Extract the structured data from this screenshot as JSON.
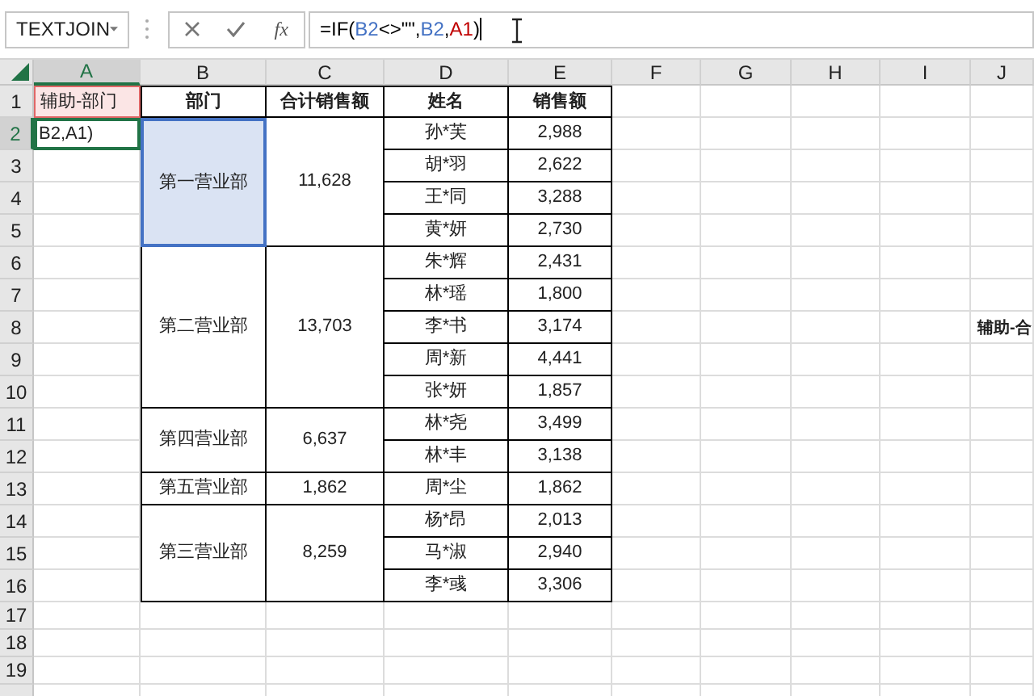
{
  "name_box": {
    "value": "TEXTJOIN"
  },
  "formula_bar": {
    "function_button": "fx",
    "formula": [
      {
        "text": "=IF(",
        "color": "#000000"
      },
      {
        "text": "B2",
        "color": "#4472c4"
      },
      {
        "text": "<>\"\",",
        "color": "#000000"
      },
      {
        "text": "B2",
        "color": "#4472c4"
      },
      {
        "text": ",",
        "color": "#000000"
      },
      {
        "text": "A1",
        "color": "#c00000"
      },
      {
        "text": ")",
        "color": "#000000"
      }
    ]
  },
  "columns": [
    {
      "label": "A",
      "selected": true
    },
    {
      "label": "B",
      "selected": false
    },
    {
      "label": "C",
      "selected": false
    },
    {
      "label": "D",
      "selected": false
    },
    {
      "label": "E",
      "selected": false
    },
    {
      "label": "F",
      "selected": false
    },
    {
      "label": "G",
      "selected": false
    },
    {
      "label": "H",
      "selected": false
    },
    {
      "label": "I",
      "selected": false
    },
    {
      "label": "J",
      "selected": false
    }
  ],
  "rows": [
    {
      "label": "1",
      "selected": false
    },
    {
      "label": "2",
      "selected": true
    },
    {
      "label": "3",
      "selected": false
    },
    {
      "label": "4",
      "selected": false
    },
    {
      "label": "5",
      "selected": false
    },
    {
      "label": "6",
      "selected": false
    },
    {
      "label": "7",
      "selected": false
    },
    {
      "label": "8",
      "selected": false
    },
    {
      "label": "9",
      "selected": false
    },
    {
      "label": "10",
      "selected": false
    },
    {
      "label": "11",
      "selected": false
    },
    {
      "label": "12",
      "selected": false
    },
    {
      "label": "13",
      "selected": false
    },
    {
      "label": "14",
      "selected": false
    },
    {
      "label": "15",
      "selected": false
    },
    {
      "label": "16",
      "selected": false
    },
    {
      "label": "17",
      "selected": false
    },
    {
      "label": "18",
      "selected": false
    },
    {
      "label": "19",
      "selected": false
    }
  ],
  "helper_column": {
    "header": "辅助-部门",
    "editing_text": "B2,A1)"
  },
  "table": {
    "headers": [
      "部门",
      "合计销售额",
      "姓名",
      "销售额"
    ],
    "groups": [
      {
        "department": "第一营业部",
        "total": "11,628",
        "highlighted": true,
        "people": [
          {
            "name": "孙*芙",
            "sales": "2,988"
          },
          {
            "name": "胡*羽",
            "sales": "2,622"
          },
          {
            "name": "王*同",
            "sales": "3,288"
          },
          {
            "name": "黄*妍",
            "sales": "2,730"
          }
        ]
      },
      {
        "department": "第二营业部",
        "total": "13,703",
        "highlighted": false,
        "people": [
          {
            "name": "朱*辉",
            "sales": "2,431"
          },
          {
            "name": "林*瑶",
            "sales": "1,800"
          },
          {
            "name": "李*书",
            "sales": "3,174"
          },
          {
            "name": "周*新",
            "sales": "4,441"
          },
          {
            "name": "张*妍",
            "sales": "1,857"
          }
        ]
      },
      {
        "department": "第四营业部",
        "total": "6,637",
        "highlighted": false,
        "people": [
          {
            "name": "林*尧",
            "sales": "3,499"
          },
          {
            "name": "林*丰",
            "sales": "3,138"
          }
        ]
      },
      {
        "department": "第五营业部",
        "total": "1,862",
        "highlighted": false,
        "people": [
          {
            "name": "周*尘",
            "sales": "1,862"
          }
        ]
      },
      {
        "department": "第三营业部",
        "total": "8,259",
        "highlighted": false,
        "people": [
          {
            "name": "杨*昂",
            "sales": "2,013"
          },
          {
            "name": "马*淑",
            "sales": "2,940"
          },
          {
            "name": "李*彧",
            "sales": "3,306"
          }
        ]
      }
    ]
  },
  "side_label": "辅助-合"
}
